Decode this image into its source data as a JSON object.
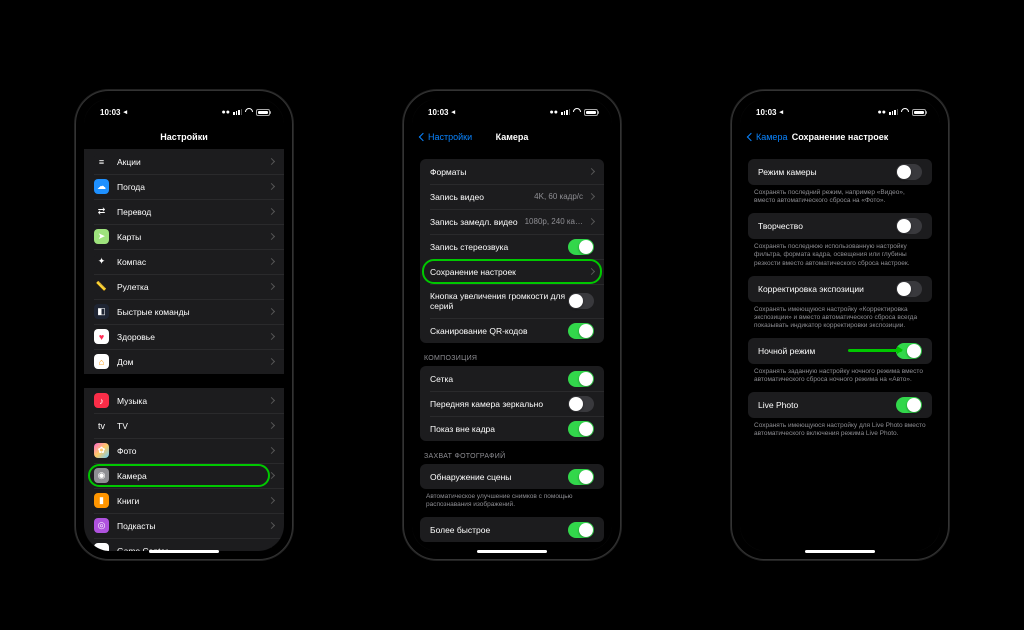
{
  "status": {
    "time": "10:03",
    "loc": "◂"
  },
  "p1": {
    "title": "Настройки",
    "g1": [
      {
        "icon": "stocks",
        "glyph": "≡",
        "label": "Акции"
      },
      {
        "icon": "weather",
        "glyph": "☁",
        "label": "Погода"
      },
      {
        "icon": "translate",
        "glyph": "⇄",
        "label": "Перевод"
      },
      {
        "icon": "maps",
        "glyph": "➤",
        "label": "Карты"
      },
      {
        "icon": "compass",
        "glyph": "✦",
        "label": "Компас"
      },
      {
        "icon": "measure",
        "glyph": "📏",
        "label": "Рулетка"
      },
      {
        "icon": "shortcuts",
        "glyph": "◧",
        "label": "Быстрые команды"
      },
      {
        "icon": "health",
        "glyph": "♥",
        "label": "Здоровье"
      },
      {
        "icon": "home",
        "glyph": "⌂",
        "label": "Дом"
      }
    ],
    "g2": [
      {
        "icon": "music",
        "glyph": "♪",
        "label": "Музыка"
      },
      {
        "icon": "tv",
        "glyph": "tv",
        "label": "TV"
      },
      {
        "icon": "photos",
        "glyph": "✿",
        "label": "Фото"
      },
      {
        "icon": "camera",
        "glyph": "◉",
        "label": "Камера",
        "hl": true
      },
      {
        "icon": "books",
        "glyph": "▮",
        "label": "Книги"
      },
      {
        "icon": "podcasts",
        "glyph": "◎",
        "label": "Подкасты"
      },
      {
        "icon": "gc",
        "glyph": "●●",
        "label": "Game Center"
      }
    ]
  },
  "p2": {
    "back": "Настройки",
    "title": "Камера",
    "g1": [
      {
        "label": "Форматы",
        "type": "chev"
      },
      {
        "label": "Запись видео",
        "detail": "4K, 60 кадр/с",
        "type": "chev"
      },
      {
        "label": "Запись замедл. видео",
        "detail": "1080p, 240 ка…",
        "type": "chev"
      },
      {
        "label": "Запись стереозвука",
        "type": "toggle",
        "on": true
      },
      {
        "label": "Сохранение настроек",
        "type": "chev",
        "hl": true
      },
      {
        "label": "Кнопка увеличения громкости для серий",
        "type": "toggle",
        "on": false,
        "tall": true
      },
      {
        "label": "Сканирование QR-кодов",
        "type": "toggle",
        "on": true
      }
    ],
    "h2": "КОМПОЗИЦИЯ",
    "g2": [
      {
        "label": "Сетка",
        "type": "toggle",
        "on": true
      },
      {
        "label": "Передняя камера зеркально",
        "type": "toggle",
        "on": false
      },
      {
        "label": "Показ вне кадра",
        "type": "toggle",
        "on": true
      }
    ],
    "h3": "ЗАХВАТ ФОТОГРАФИЙ",
    "g3": [
      {
        "label": "Обнаружение сцены",
        "type": "toggle",
        "on": true
      }
    ],
    "f3": "Автоматическое улучшение снимков с помощью распознавания изображений.",
    "g4": [
      {
        "label": "Более быстрое",
        "type": "toggle",
        "on": true
      }
    ]
  },
  "p3": {
    "back": "Камера",
    "title": "Сохранение настроек",
    "rows": [
      {
        "label": "Режим камеры",
        "on": false,
        "foot": "Сохранять последний режим, например «Видео», вместо автоматического сброса на «Фото»."
      },
      {
        "label": "Творчество",
        "on": false,
        "foot": "Сохранять последнюю использованную настройку фильтра, формата кадра, освещения или глубины резкости вместо автоматического сброса настроек."
      },
      {
        "label": "Корректировка экспозиции",
        "on": false,
        "foot": "Сохранять имеющуюся настройку «Корректировка экспозиции» и вместо автоматического сброса всегда показывать индикатор корректировки экспозиции."
      },
      {
        "label": "Ночной режим",
        "on": true,
        "arrow": true,
        "foot": "Сохранять заданную настройку ночного режима вместо автоматического сброса ночного режима на «Авто»."
      },
      {
        "label": "Live Photo",
        "on": true,
        "foot": "Сохранять имеющуюся настройку для Live Photo вместо автоматического включения режима Live Photo."
      }
    ]
  }
}
